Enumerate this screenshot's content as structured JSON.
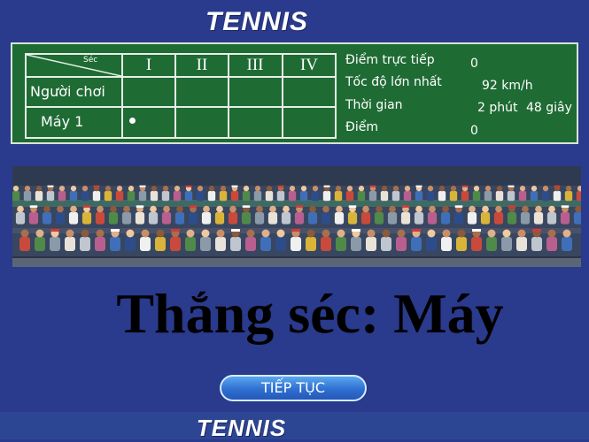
{
  "header": {
    "logo_text": "TENNIS"
  },
  "footer": {
    "logo_text": "TENNIS"
  },
  "scoreboard": {
    "corner_label": "Séc",
    "sets": [
      "I",
      "II",
      "III",
      "IV"
    ],
    "rows": [
      {
        "name": "Người chơi",
        "scores": [
          "",
          "",
          "",
          ""
        ]
      },
      {
        "name": "Máy 1",
        "scores": [
          "",
          "",
          "",
          ""
        ],
        "serving": true
      }
    ]
  },
  "stats": {
    "live_points": {
      "label": "Điểm trực tiếp",
      "value": "0"
    },
    "top_speed": {
      "label": "Tốc độ lớn nhất",
      "value": "92 km/h"
    },
    "time": {
      "label": "Thời gian",
      "minutes": "2 phút",
      "seconds": "48 giây"
    },
    "points": {
      "label": "Điểm",
      "value": "0"
    }
  },
  "result": {
    "text": "Thắng séc: Máy"
  },
  "buttons": {
    "continue_label": "TIẾP TỤC"
  },
  "colors": {
    "background": "#2a3a8c",
    "panel": "#1f6b34",
    "button": "#3b86e0"
  }
}
